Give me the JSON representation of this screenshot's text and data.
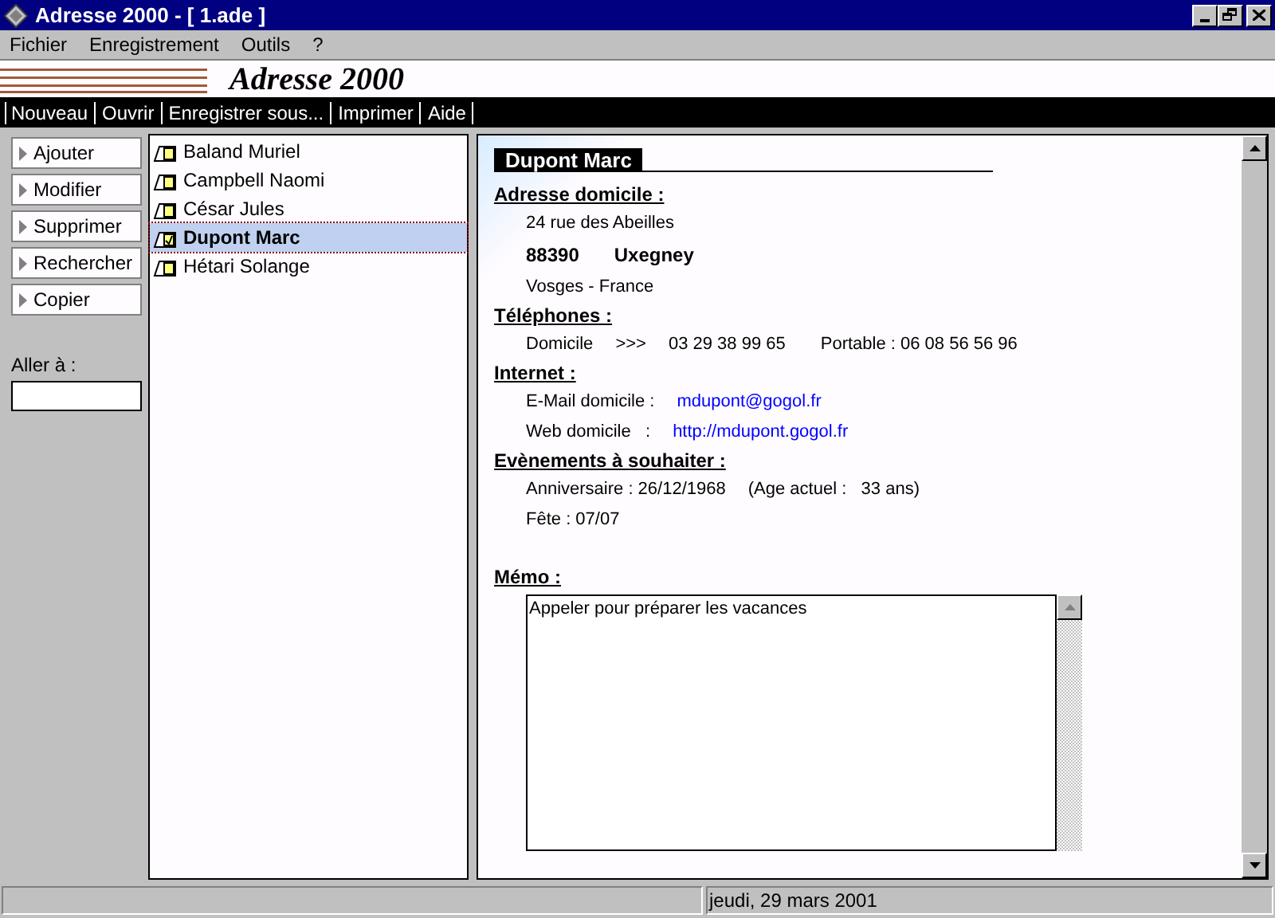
{
  "window": {
    "title": "Adresse 2000 - [ 1.ade ]"
  },
  "menu": [
    "Fichier",
    "Enregistrement",
    "Outils",
    "?"
  ],
  "banner": {
    "title": "Adresse 2000"
  },
  "toolbar": [
    "Nouveau",
    "Ouvrir",
    "Enregistrer sous...",
    "Imprimer",
    "Aide"
  ],
  "actions": [
    "Ajouter",
    "Modifier",
    "Supprimer",
    "Rechercher",
    "Copier"
  ],
  "goto": {
    "label": "Aller à :"
  },
  "contacts": [
    {
      "name": "Baland Muriel",
      "selected": false
    },
    {
      "name": "Campbell Naomi",
      "selected": false
    },
    {
      "name": "César Jules",
      "selected": false
    },
    {
      "name": "Dupont Marc",
      "selected": true
    },
    {
      "name": "Hétari Solange",
      "selected": false
    }
  ],
  "detail": {
    "name": "Dupont Marc",
    "address": {
      "heading": "Adresse domicile :",
      "street": "24 rue des Abeilles",
      "postcode": "88390",
      "city": "Uxegney",
      "region": "Vosges - France"
    },
    "phones": {
      "heading": "Téléphones :",
      "home_label": "Domicile",
      "arrow": ">>>",
      "home_number": "03 29 38 99 65",
      "mobile": "Portable : 06 08 56 56 96"
    },
    "internet": {
      "heading": "Internet :",
      "email_label": "E-Mail domicile :",
      "email": "mdupont@gogol.fr",
      "web_label": "Web domicile   :",
      "web": "http://mdupont.gogol.fr"
    },
    "events": {
      "heading": "Evènements à souhaiter :",
      "birthday": "Anniversaire : 26/12/1968",
      "age": "(Age actuel :   33 ans)",
      "name_day": "Fête : 07/07"
    },
    "memo": {
      "heading": "Mémo :",
      "text": "Appeler pour préparer les vacances"
    }
  },
  "status_bar": {
    "date": "jeudi, 29 mars 2001"
  }
}
